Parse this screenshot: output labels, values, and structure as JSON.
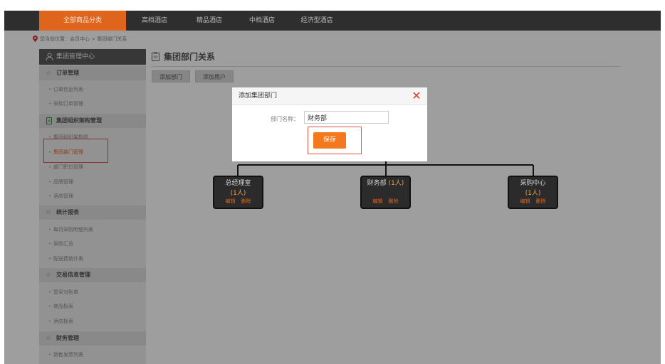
{
  "nav": {
    "items": [
      {
        "label": "全部商品分类",
        "active": true
      },
      {
        "label": "高档酒店",
        "active": false
      },
      {
        "label": "精品酒店",
        "active": false
      },
      {
        "label": "中档酒店",
        "active": false
      },
      {
        "label": "经济型酒店",
        "active": false
      }
    ]
  },
  "breadcrumb": "您当前位置：会员中心 > 集团部门关系",
  "sidebar": {
    "title": "集团管理中心",
    "sections": [
      {
        "label": "订单管理",
        "items": [
          "订单信息列表",
          "采购订单管理"
        ]
      },
      {
        "label": "集团组织架构管理",
        "items": [
          "集团组织架构图",
          "集团部门管理",
          "部门职位管理",
          "品牌管理",
          "酒店管理"
        ]
      },
      {
        "label": "统计报表",
        "items": [
          "每月采购明细列表",
          "采购汇总",
          "配送费统计表"
        ]
      },
      {
        "label": "交易信息管理",
        "items": [
          "暂采对账单",
          "商品报表",
          "酒店报表"
        ]
      },
      {
        "label": "财务管理",
        "items": [
          "销售发票列表"
        ]
      }
    ]
  },
  "page": {
    "title": "集团部门关系",
    "add_dept_button": "添加部门",
    "add_user_button": "添加用户"
  },
  "org_nodes": [
    {
      "name": "总经理室",
      "count": "(1人)",
      "edit": "编辑",
      "delete": "删除"
    },
    {
      "name": "财务部",
      "count": "(1人)",
      "edit": "编辑",
      "delete": "删除"
    },
    {
      "name": "采购中心",
      "count": "(1人)",
      "edit": "编辑",
      "delete": "删除"
    }
  ],
  "modal": {
    "title": "添加集团部门",
    "field_label": "部门名称：",
    "field_value": "财务部",
    "save_label": "保存"
  },
  "colors": {
    "accent": "#e0651c",
    "nav_bg": "#2e2e2e",
    "close": "#e03a2a",
    "save": "#f4781d"
  }
}
